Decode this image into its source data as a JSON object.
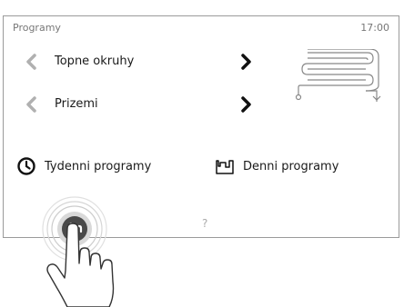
{
  "header": {
    "title": "Programy",
    "time": "17:00"
  },
  "selectors": [
    {
      "label": "Topne okruhy",
      "prev_icon": "chevron-left-icon",
      "next_icon": "chevron-right-icon"
    },
    {
      "label": "Prizemi",
      "prev_icon": "chevron-left-icon",
      "next_icon": "chevron-right-icon"
    }
  ],
  "heating_icon": "floor-heating-pipe-icon",
  "programs": {
    "weekly": {
      "label": "Tydenni programy",
      "icon": "clock-icon"
    },
    "daily": {
      "label": "Denni programy",
      "icon": "daily-profile-icon"
    }
  },
  "footer": {
    "help_label": "?",
    "back_icon": "back-arrow-icon"
  },
  "colors": {
    "text": "#1a1a1a",
    "muted": "#777777",
    "chevron_inactive": "#b0b0b0",
    "border": "#9a9a9a"
  }
}
